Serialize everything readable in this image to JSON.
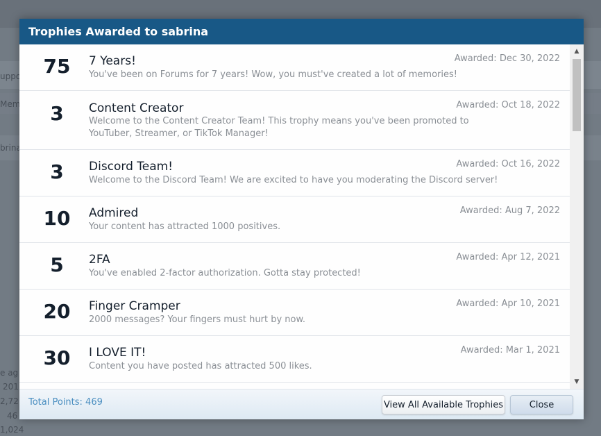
{
  "background": {
    "fragments": [
      "uppo",
      "Mem",
      "brina",
      "e ag",
      "201",
      "2,72",
      "46",
      "1,024"
    ]
  },
  "modal": {
    "title": "Trophies Awarded to sabrina",
    "trophies": [
      {
        "points": "75",
        "name": "7 Years!",
        "description": "You've been on Forums for 7 years! Wow, you must've created a lot of memories!",
        "awarded": "Awarded: Dec 30, 2022"
      },
      {
        "points": "3",
        "name": "Content Creator",
        "description": "Welcome to the Content Creator Team! This trophy means you've been promoted to YouTuber, Streamer, or TikTok Manager!",
        "awarded": "Awarded: Oct 18, 2022"
      },
      {
        "points": "3",
        "name": "Discord Team!",
        "description": "Welcome to the Discord Team! We are excited to have you moderating the Discord server!",
        "awarded": "Awarded: Oct 16, 2022"
      },
      {
        "points": "10",
        "name": "Admired",
        "description": "Your content has attracted 1000 positives.",
        "awarded": "Awarded: Aug 7, 2022"
      },
      {
        "points": "5",
        "name": "2FA",
        "description": "You've enabled 2-factor authorization. Gotta stay protected!",
        "awarded": "Awarded: Apr 12, 2021"
      },
      {
        "points": "20",
        "name": "Finger Cramper",
        "description": "2000 messages? Your fingers must hurt by now.",
        "awarded": "Awarded: Apr 10, 2021"
      },
      {
        "points": "30",
        "name": "I LOVE IT!",
        "description": "Content you have posted has attracted 500 likes.",
        "awarded": "Awarded: Mar 1, 2021"
      }
    ],
    "footer": {
      "total_points": "Total Points: 469",
      "view_all_label": "View All Available Trophies",
      "close_label": "Close"
    },
    "scrollbar": {
      "up_arrow": "▲",
      "down_arrow": "▼"
    }
  },
  "colors": {
    "header": "#185886",
    "accent_text": "#4a8ec0"
  }
}
